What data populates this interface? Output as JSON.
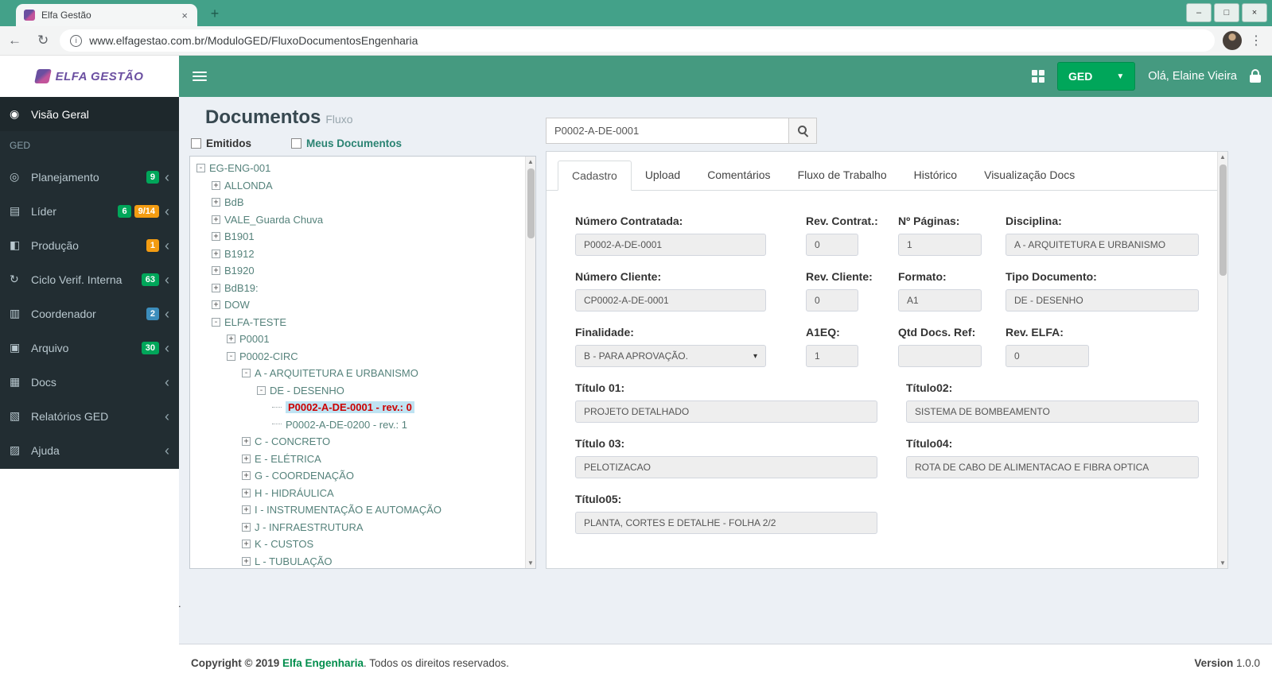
{
  "browser": {
    "tab_title": "Elfa Gestão",
    "url": "www.elfagestao.com.br/ModuloGED/FluxoDocumentosEngenharia"
  },
  "header": {
    "app_name": "ELFA GESTÃO",
    "app_switcher_label": "GED",
    "greeting": "Olá, Elaine Vieira"
  },
  "sidebar": {
    "items": [
      {
        "type": "item",
        "label": "Visão Geral",
        "icon": "globe-icon",
        "active": true,
        "badges": [],
        "chevron": false
      },
      {
        "type": "header",
        "label": "GED"
      },
      {
        "type": "item",
        "label": "Planejamento",
        "icon": "pin-icon",
        "badges": [
          {
            "text": "9",
            "color": "green"
          }
        ],
        "chevron": true
      },
      {
        "type": "item",
        "label": "Líder",
        "icon": "map-icon",
        "badges": [
          {
            "text": "6",
            "color": "green"
          },
          {
            "text": "9/14",
            "color": "yellow"
          }
        ],
        "chevron": true
      },
      {
        "type": "item",
        "label": "Produção",
        "icon": "wrench-icon",
        "badges": [
          {
            "text": "1",
            "color": "yellow"
          }
        ],
        "chevron": true
      },
      {
        "type": "item",
        "label": "Ciclo Verif. Interna",
        "icon": "refresh-icon",
        "badges": [
          {
            "text": "63",
            "color": "green"
          }
        ],
        "chevron": true
      },
      {
        "type": "item",
        "label": "Coordenador",
        "icon": "chart-icon",
        "badges": [
          {
            "text": "2",
            "color": "blue"
          }
        ],
        "chevron": true
      },
      {
        "type": "item",
        "label": "Arquivo",
        "icon": "tablet-icon",
        "badges": [
          {
            "text": "30",
            "color": "green"
          }
        ],
        "chevron": true
      },
      {
        "type": "item",
        "label": "Docs",
        "icon": "folder-icon",
        "badges": [],
        "chevron": true
      },
      {
        "type": "item",
        "label": "Relatórios GED",
        "icon": "report-icon",
        "badges": [],
        "chevron": true
      },
      {
        "type": "item",
        "label": "Ajuda",
        "icon": "book-icon",
        "badges": [],
        "chevron": true
      }
    ]
  },
  "page": {
    "title": "Documentos",
    "subtitle": "Fluxo",
    "filters": [
      {
        "label": "Emitidos",
        "checked": false
      },
      {
        "label": "Meus Documentos",
        "checked": false
      }
    ],
    "stray_text": "."
  },
  "tree": {
    "nodes": [
      {
        "label": "EG-ENG-001",
        "level": 0,
        "state": "expanded"
      },
      {
        "label": "ALLONDA",
        "level": 1,
        "state": "collapsed"
      },
      {
        "label": "BdB",
        "level": 1,
        "state": "collapsed"
      },
      {
        "label": "VALE_Guarda Chuva",
        "level": 1,
        "state": "collapsed"
      },
      {
        "label": "B1901",
        "level": 1,
        "state": "collapsed"
      },
      {
        "label": "B1912",
        "level": 1,
        "state": "collapsed"
      },
      {
        "label": "B1920",
        "level": 1,
        "state": "collapsed"
      },
      {
        "label": "BdB19:",
        "level": 1,
        "state": "collapsed"
      },
      {
        "label": "DOW",
        "level": 1,
        "state": "collapsed"
      },
      {
        "label": "ELFA-TESTE",
        "level": 1,
        "state": "expanded"
      },
      {
        "label": "P0001",
        "level": 2,
        "state": "collapsed"
      },
      {
        "label": "P0002-CIRC",
        "level": 2,
        "state": "expanded"
      },
      {
        "label": "A - ARQUITETURA E URBANISMO",
        "level": 3,
        "state": "expanded"
      },
      {
        "label": "DE - DESENHO",
        "level": 4,
        "state": "expanded"
      },
      {
        "label": "P0002-A-DE-0001 - rev.: 0",
        "level": 5,
        "state": "leaf",
        "selected": true
      },
      {
        "label": "P0002-A-DE-0200 - rev.: 1",
        "level": 5,
        "state": "leaf"
      },
      {
        "label": "C - CONCRETO",
        "level": 3,
        "state": "collapsed"
      },
      {
        "label": "E - ELÉTRICA",
        "level": 3,
        "state": "collapsed"
      },
      {
        "label": "G - COORDENAÇÃO",
        "level": 3,
        "state": "collapsed"
      },
      {
        "label": "H - HIDRÁULICA",
        "level": 3,
        "state": "collapsed"
      },
      {
        "label": "I - INSTRUMENTAÇÃO E AUTOMAÇÃO",
        "level": 3,
        "state": "collapsed"
      },
      {
        "label": "J - INFRAESTRUTURA",
        "level": 3,
        "state": "collapsed"
      },
      {
        "label": "K - CUSTOS",
        "level": 3,
        "state": "collapsed"
      },
      {
        "label": "L - TUBULAÇÃO",
        "level": 3,
        "state": "collapsed"
      }
    ]
  },
  "search": {
    "value": "P0002-A-DE-0001"
  },
  "tabs": [
    {
      "label": "Cadastro",
      "active": true
    },
    {
      "label": "Upload"
    },
    {
      "label": "Comentários"
    },
    {
      "label": "Fluxo de Trabalho"
    },
    {
      "label": "Histórico"
    },
    {
      "label": "Visualização Docs"
    }
  ],
  "form": {
    "rows": [
      [
        {
          "label": "Número Contratada:",
          "value": "P0002-A-DE-0001"
        },
        {
          "label": "Rev. Contrat.:",
          "value": "0"
        },
        {
          "label": "Nº Páginas:",
          "value": "1"
        },
        {
          "label": "Disciplina:",
          "value": "A - ARQUITETURA E URBANISMO"
        }
      ],
      [
        {
          "label": "Número Cliente:",
          "value": "CP0002-A-DE-0001"
        },
        {
          "label": "Rev. Cliente:",
          "value": "0"
        },
        {
          "label": "Formato:",
          "value": "A1"
        },
        {
          "label": "Tipo Documento:",
          "value": "DE - DESENHO"
        }
      ],
      [
        {
          "label": "Finalidade:",
          "value": "B - PARA APROVAÇÃO.",
          "type": "select"
        },
        {
          "label": "A1EQ:",
          "value": "1"
        },
        {
          "label": "Qtd Docs. Ref:",
          "value": ""
        },
        {
          "label": "Rev. ELFA:",
          "value": "0"
        }
      ],
      [
        {
          "label": "Título 01:",
          "value": "PROJETO DETALHADO"
        },
        {
          "label": "Título02:",
          "value": "SISTEMA DE BOMBEAMENTO"
        }
      ],
      [
        {
          "label": "Título 03:",
          "value": "PELOTIZACAO"
        },
        {
          "label": "Título04:",
          "value": "ROTA DE CABO DE ALIMENTACAO E FIBRA OPTICA"
        }
      ],
      [
        {
          "label": "Título05:",
          "value": "PLANTA, CORTES E DETALHE - FOLHA 2/2"
        }
      ]
    ]
  },
  "footer": {
    "copyright_prefix": "Copyright © 2019",
    "company": "Elfa Engenharia",
    "copyright_suffix": ". Todos os direitos reservados.",
    "version_label": "Version",
    "version": "1.0.0"
  },
  "colors": {
    "accent_green": "#00a65a",
    "header_teal": "#459a80",
    "badge_yellow": "#f39c12",
    "badge_blue": "#3c8dbc",
    "selected_doc_red": "#cc0000"
  }
}
